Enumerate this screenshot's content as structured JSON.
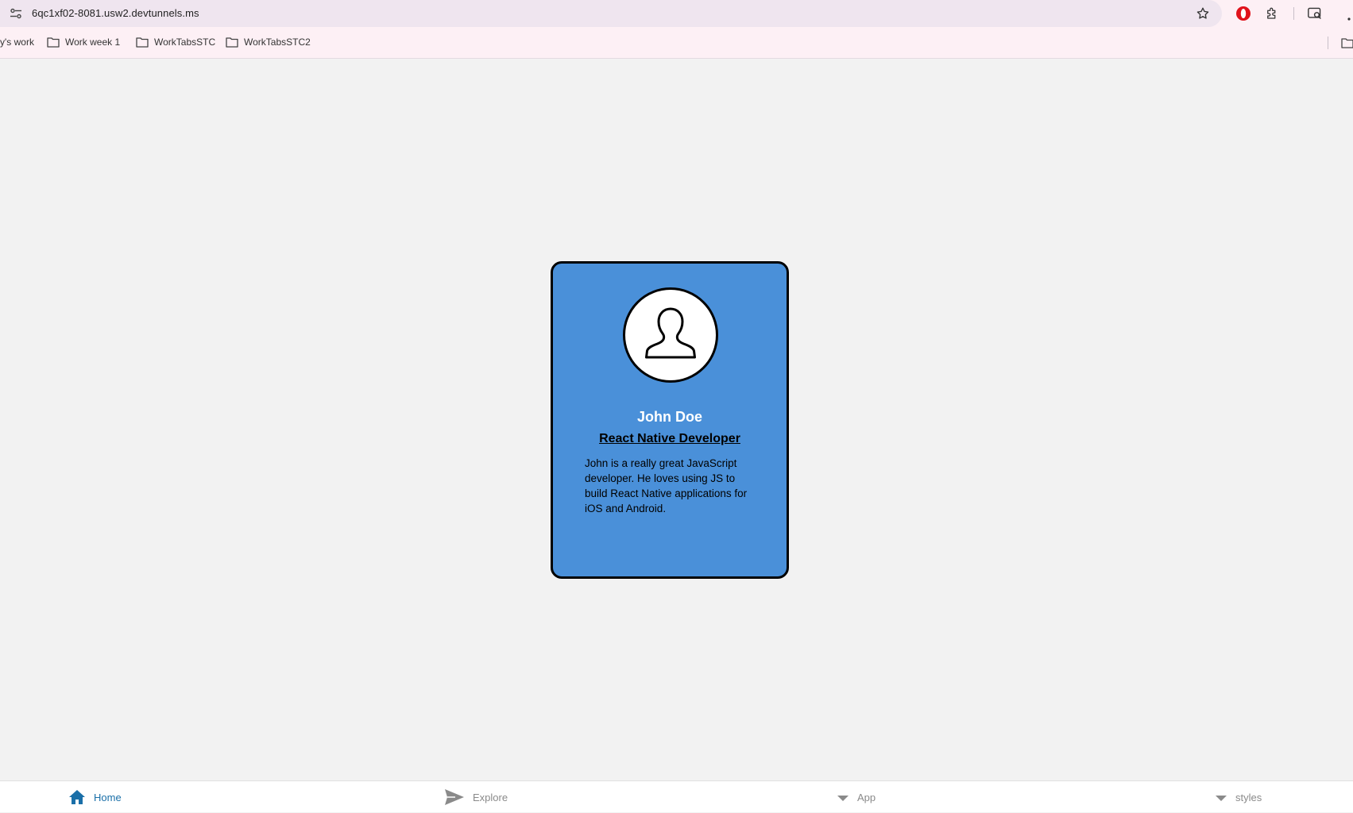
{
  "browser": {
    "url": "6qc1xf02-8081.usw2.devtunnels.ms",
    "bookmarks": [
      {
        "label": "y's work"
      },
      {
        "label": "Work week 1"
      },
      {
        "label": "WorkTabsSTC"
      },
      {
        "label": "WorkTabsSTC2"
      }
    ]
  },
  "card": {
    "name": "John Doe",
    "role": "React Native Developer",
    "bio": "John is a really great JavaScript developer. He loves using JS to build React Native applications for iOS and Android.",
    "background_color": "#4a90d9"
  },
  "tabs": [
    {
      "label": "Home",
      "icon": "home-icon",
      "active": true
    },
    {
      "label": "Explore",
      "icon": "send-icon",
      "active": false
    },
    {
      "label": "App",
      "icon": "caret-down-icon",
      "active": false
    },
    {
      "label": "styles",
      "icon": "caret-down-icon",
      "active": false
    }
  ],
  "colors": {
    "active_tab": "#1a6fa8",
    "inactive_tab": "#8a8a8a",
    "page_bg": "#f2f2f2"
  }
}
